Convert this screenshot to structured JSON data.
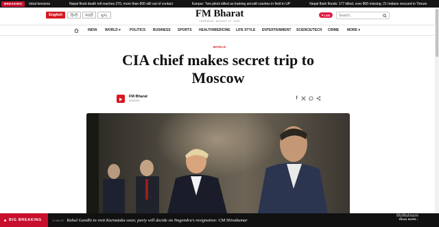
{
  "ticker": {
    "tag": "BREAKING",
    "items": [
      "lobal tensions",
      "Nepal flood death toll reaches 270, more than 800 still out of contact",
      "Kanpur: Two pilots killed as training aircraft crashes in field in UP",
      "Nepal flash floods: 177 killed, over 800 missing; 21 Indians rescued in Timure"
    ]
  },
  "header": {
    "languages": [
      "English",
      "हिन्दी",
      "मराठी",
      "ગુજ."
    ],
    "logo": "FM Bharat",
    "date": "THURSDAY, AUGUST 27, 2026",
    "live_label": "LIVE",
    "search_placeholder": "Search..."
  },
  "nav": [
    "INDIA",
    "WORLD",
    "POLITICS",
    "BUSINESS",
    "SPORTS",
    "HEALTH/MEDICINE",
    "LIFE STYLE",
    "ENTERTAINMENT",
    "SCIENCE/TECH",
    "CRIME",
    "MORE"
  ],
  "article": {
    "category": "WORLD",
    "headline_line1": "CIA chief makes secret trip to",
    "headline_line2": "Moscow",
    "author": "FM Bharat",
    "date": "8/25/2026"
  },
  "breaking_bar": {
    "label": "BIG BREAKING",
    "time": "17:38 IST",
    "story": "Rahul Gandhi to visit Karnataka soon; party will decide on Nagendra's resignation: CM Shivakumar",
    "read_more": "READ MORE",
    "watermark": "MyMalware"
  },
  "colors": {
    "brand_red": "#d71920",
    "breaking_red": "#c8102e",
    "ticker_bg": "#141414"
  }
}
